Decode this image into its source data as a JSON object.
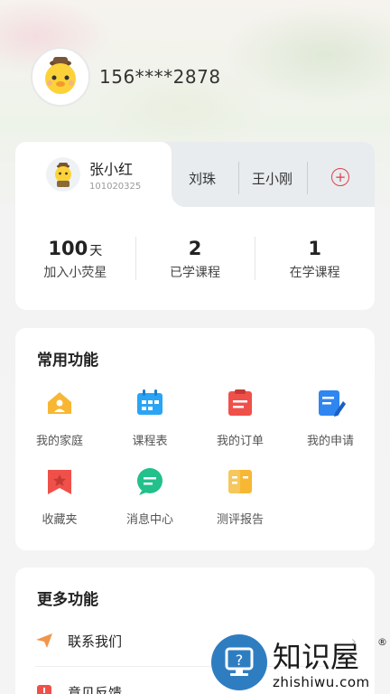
{
  "user": {
    "phone": "156****2878"
  },
  "children": {
    "active": {
      "name": "张小红",
      "id": "101020325"
    },
    "others": [
      "刘珠",
      "王小刚"
    ],
    "add_symbol": "+"
  },
  "stats": [
    {
      "value": "100",
      "unit": "天",
      "label": "加入小荧星"
    },
    {
      "value": "2",
      "unit": "",
      "label": "已学课程"
    },
    {
      "value": "1",
      "unit": "",
      "label": "在学课程"
    }
  ],
  "functions": {
    "title": "常用功能",
    "items": [
      {
        "label": "我的家庭",
        "icon": "home-icon",
        "color": "#f7b733"
      },
      {
        "label": "课程表",
        "icon": "calendar-icon",
        "color": "#2aa4f4"
      },
      {
        "label": "我的订单",
        "icon": "order-icon",
        "color": "#f0504a"
      },
      {
        "label": "我的申请",
        "icon": "application-icon",
        "color": "#2f86f0"
      },
      {
        "label": "收藏夹",
        "icon": "favorites-icon",
        "color": "#f0504a"
      },
      {
        "label": "消息中心",
        "icon": "message-icon",
        "color": "#22c08a"
      },
      {
        "label": "测评报告",
        "icon": "report-icon",
        "color": "#f7b733"
      }
    ]
  },
  "more": {
    "title": "更多功能",
    "items": [
      {
        "label": "联系我们",
        "icon": "send-icon",
        "color": "#f0954a"
      },
      {
        "label": "意见反馈",
        "icon": "feedback-icon",
        "color": "#f0504a"
      }
    ]
  },
  "watermark": {
    "text": "知识屋",
    "url": "zhishiwu.com",
    "reg": "®",
    "color": "#2f7dc1"
  }
}
